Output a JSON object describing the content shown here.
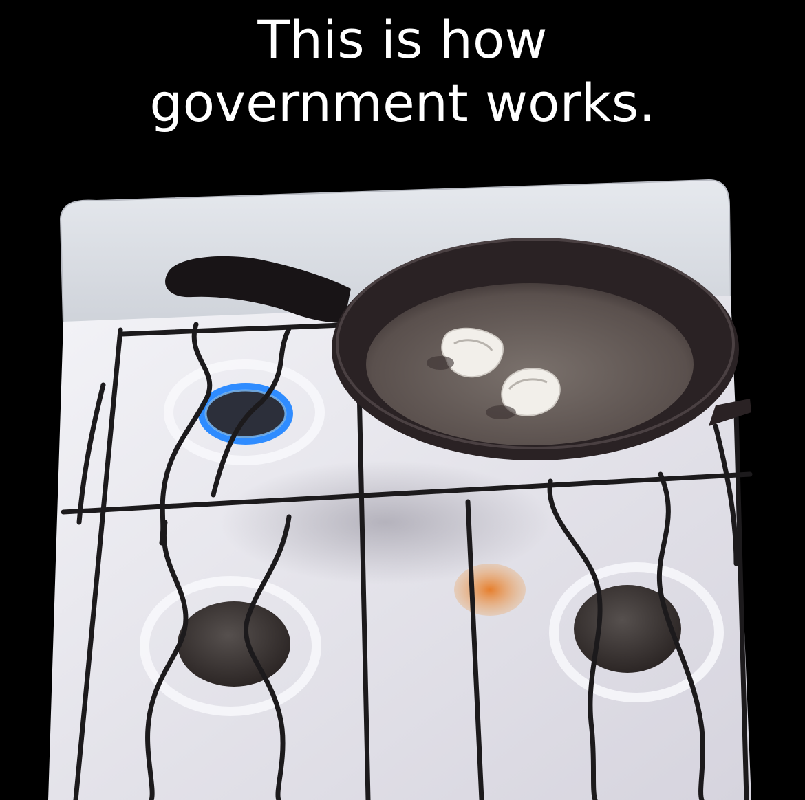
{
  "caption": {
    "line1": "This is how",
    "line2": "government works."
  },
  "scene": {
    "colors": {
      "background": "#000000",
      "caption_text": "#ffffff",
      "stove_enamel": "#e4e4ea",
      "grate": "#1c1a1c",
      "pan": "#2a2224",
      "pan_inner": "#6e6560",
      "flame": "#2f8cff",
      "burner_cap": "#3e3634",
      "eggshell": "#f2efea",
      "yolk_stain": "#e0883a"
    },
    "icons": [
      "frying-pan-icon",
      "gas-flame-icon",
      "eggshell-icon",
      "burner-icon",
      "grate-icon"
    ]
  }
}
